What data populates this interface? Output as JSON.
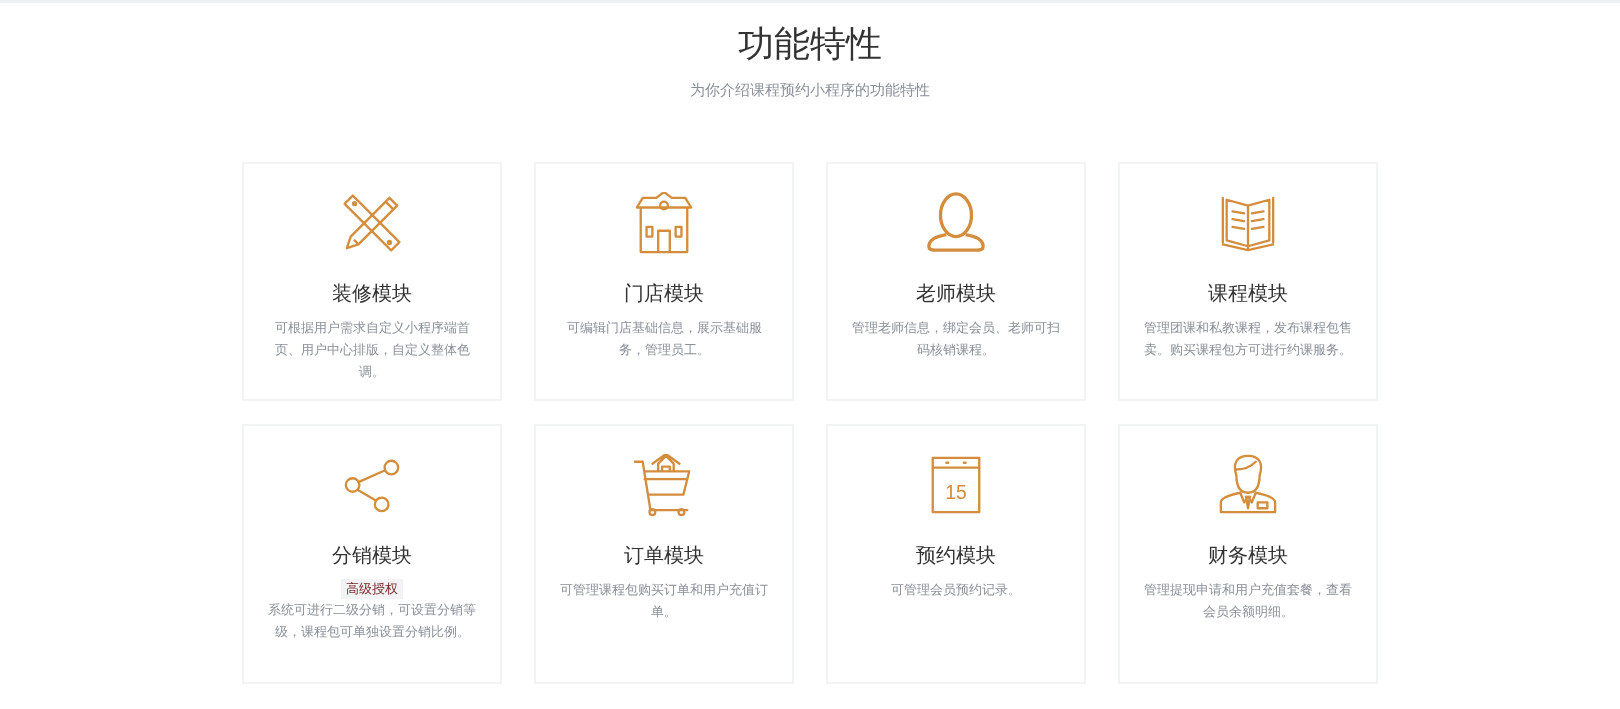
{
  "header": {
    "title": "功能特性",
    "subtitle": "为你介绍课程预约小程序的功能特性"
  },
  "features": [
    {
      "kind": "tools",
      "title": "装修模块",
      "description": "可根据用户需求自定义小程序端首页、用户中心排版，自定义整体色调。"
    },
    {
      "kind": "house",
      "title": "门店模块",
      "description": "可编辑门店基础信息，展示基础服务，管理员工。"
    },
    {
      "kind": "person",
      "title": "老师模块",
      "description": "管理老师信息，绑定会员、老师可扫码核销课程。"
    },
    {
      "kind": "book",
      "title": "课程模块",
      "description": "管理团课和私教课程，发布课程包售卖。购买课程包方可进行约课服务。"
    },
    {
      "kind": "share",
      "title": "分销模块",
      "badge": "高级授权",
      "description": "系统可进行二级分销，可设置分销等级，课程包可单独设置分销比例。"
    },
    {
      "kind": "cart",
      "title": "订单模块",
      "description": "可管理课程包购买订单和用户充值订单。"
    },
    {
      "kind": "calendar",
      "icon_label": "15",
      "title": "预约模块",
      "description": "可管理会员预约记录。"
    },
    {
      "kind": "clerk",
      "title": "财务模块",
      "description": "管理提现申请和用户充值套餐，查看会员余额明细。"
    }
  ]
}
